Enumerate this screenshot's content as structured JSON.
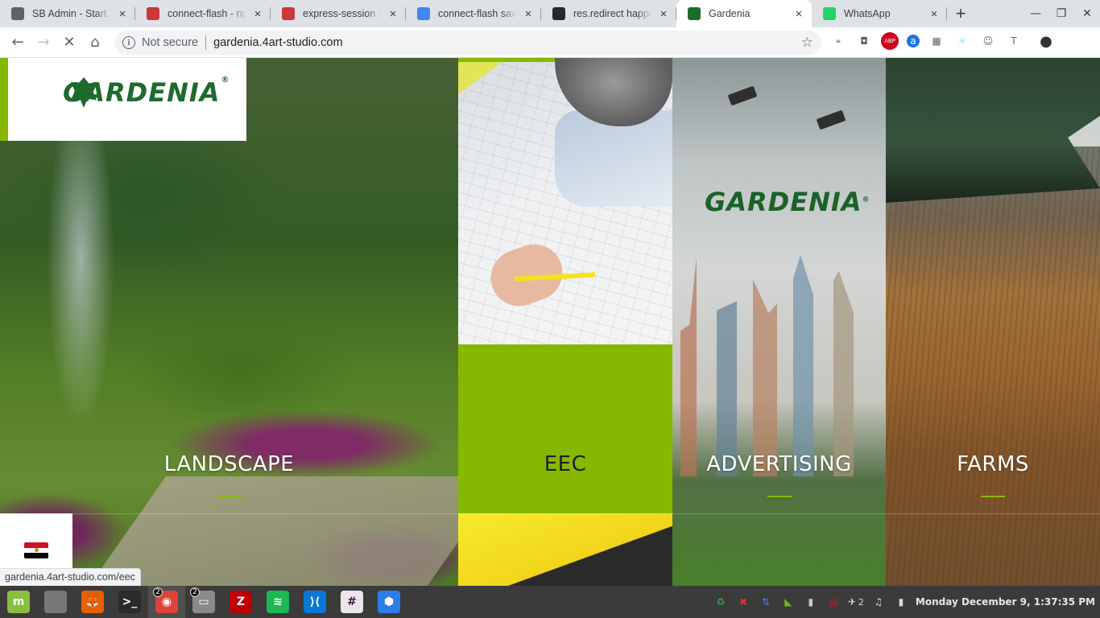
{
  "browser": {
    "tabs": [
      {
        "title": "SB Admin - Start Bootstrap",
        "favicon": "globe-icon",
        "color": "#5f6368"
      },
      {
        "title": "connect-flash - npm",
        "favicon": "npm-icon",
        "color": "#cb3837"
      },
      {
        "title": "express-session - npm",
        "favicon": "npm-icon",
        "color": "#cb3837"
      },
      {
        "title": "connect-flash save",
        "favicon": "google-icon",
        "color": "#4285f4"
      },
      {
        "title": "res.redirect happens",
        "favicon": "github-icon",
        "color": "#24292e"
      },
      {
        "title": "Gardenia",
        "favicon": "gardenia-icon",
        "color": "#1e6b2e"
      },
      {
        "title": "WhatsApp",
        "favicon": "whatsapp-icon",
        "color": "#25d366"
      }
    ],
    "active_tab": 5,
    "new_tab_label": "+",
    "address": {
      "security_label": "Not secure",
      "url": "gardenia.4art-studio.com"
    },
    "extensions": [
      "map-pin-icon",
      "camera-icon",
      "adblock-icon",
      "a-icon",
      "grid-icon",
      "react-icon",
      "octopus-icon",
      "t-icon",
      "avatar-icon"
    ],
    "status_url": "gardenia.4art-studio.com/eec"
  },
  "site": {
    "logo_text": "GARDENIA",
    "logo_mark": "®",
    "accent": "#86b800",
    "brand_green": "#1e6b2e",
    "sections": [
      {
        "label": "LANDSCAPE"
      },
      {
        "label": "EEC"
      },
      {
        "label": "ADVERTISING"
      },
      {
        "label": "FARMS"
      }
    ],
    "language_flag": "egypt-flag-icon"
  },
  "taskbar": {
    "apps": [
      {
        "name": "mint-menu-icon",
        "color": "#87c03f",
        "glyph": "m"
      },
      {
        "name": "show-desktop-icon",
        "color": "#777",
        "glyph": ""
      },
      {
        "name": "firefox-icon",
        "color": "#e66000",
        "glyph": "🦊"
      },
      {
        "name": "terminal-icon",
        "color": "#2b2b2b",
        "glyph": ">_"
      },
      {
        "name": "chrome-icon",
        "color": "#db4437",
        "glyph": "◉",
        "badge": "2"
      },
      {
        "name": "files-icon",
        "color": "#8a8a8a",
        "glyph": "▭",
        "badge": "2"
      },
      {
        "name": "filezilla-icon",
        "color": "#bf0000",
        "glyph": "Z"
      },
      {
        "name": "spotify-icon",
        "color": "#1db954",
        "glyph": "≋"
      },
      {
        "name": "vscode-icon",
        "color": "#0a78d7",
        "glyph": "⟩⟨"
      },
      {
        "name": "slack-icon",
        "color": "#e8e8e8",
        "glyph": "#"
      },
      {
        "name": "network-app-icon",
        "color": "#2b7de9",
        "glyph": "⬢"
      }
    ],
    "tray": [
      "update-icon",
      "shield-icon",
      "network-icon",
      "nvidia-icon",
      "signal-icon",
      "us-flag-icon"
    ],
    "notification_count": "2",
    "clock": "Monday December  9,  1:37:35 PM"
  }
}
